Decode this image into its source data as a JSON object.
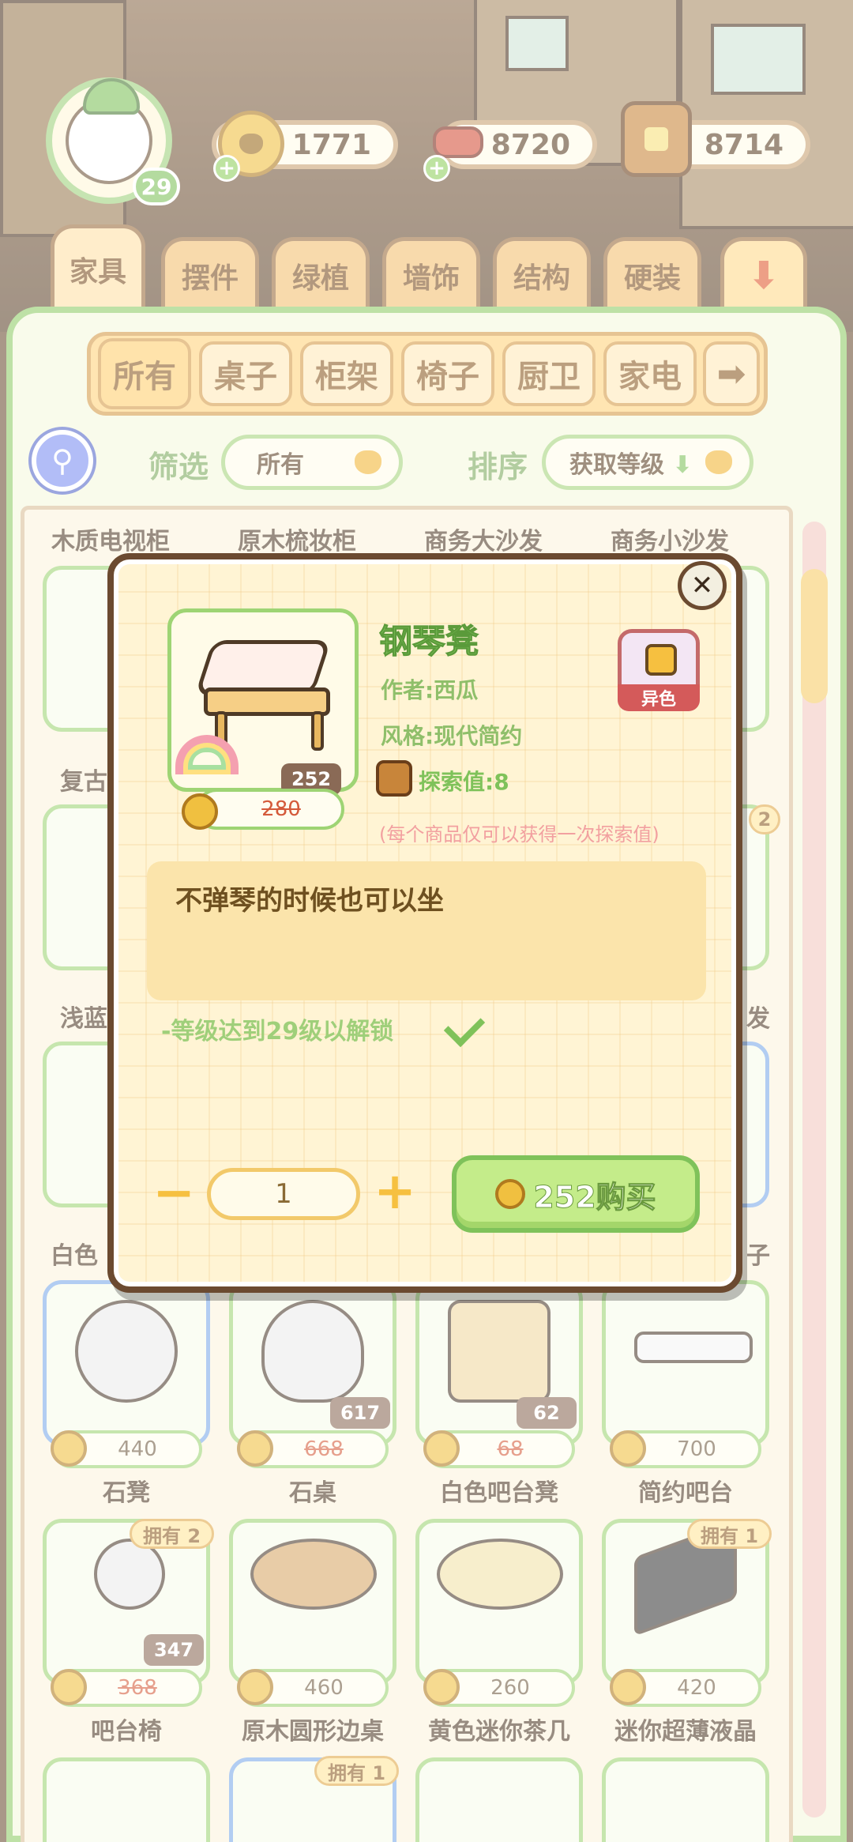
{
  "player": {
    "level": "29"
  },
  "resources": [
    {
      "name": "coins",
      "value": "1771",
      "icon": "coin-icon"
    },
    {
      "name": "material",
      "value": "8720",
      "icon": "dumbbell-icon"
    },
    {
      "name": "exploration",
      "value": "8714",
      "icon": "book-icon"
    }
  ],
  "tabs": [
    "家具",
    "摆件",
    "绿植",
    "墙饰",
    "结构",
    "硬装"
  ],
  "subtabs": [
    "所有",
    "桌子",
    "柜架",
    "椅子",
    "厨卫",
    "家电"
  ],
  "filter": {
    "label": "筛选",
    "value": "所有"
  },
  "sort": {
    "label": "排序",
    "value": "获取等级"
  },
  "column_titles": [
    "木质电视柜",
    "原木梳妆柜",
    "商务大沙发",
    "商务小沙发"
  ],
  "side_labels": {
    "left1": "复古",
    "left2": "浅蓝",
    "left3": "白色",
    "right2": "发",
    "right3": "子",
    "right_badge": "2"
  },
  "items_row1": [
    {
      "name": "石凳",
      "price": "440"
    },
    {
      "name": "石桌",
      "price": "668",
      "discount": "617"
    },
    {
      "name": "白色吧台凳",
      "price": "68",
      "discount": "62"
    },
    {
      "name": "简约吧台",
      "price": "700"
    }
  ],
  "items_row2": [
    {
      "name": "吧台椅",
      "price": "368",
      "discount": "347",
      "owned": "拥有 2"
    },
    {
      "name": "原木圆形边桌",
      "price": "460"
    },
    {
      "name": "黄色迷你茶几",
      "price": "260"
    },
    {
      "name": "迷你超薄液晶",
      "price": "420",
      "owned": "拥有 1"
    }
  ],
  "items_row3": {
    "owned": "拥有 1"
  },
  "modal": {
    "title": "钢琴凳",
    "author": "作者:西瓜",
    "style": "风格:现代简约",
    "explore": "探索值:8",
    "note": "(每个商品仅可以获得一次探索值)",
    "variant_label": "异色",
    "original_price": "280",
    "discount_price": "252",
    "description": "不弹琴的时候也可以坐",
    "unlock": "-等级达到29级以解锁",
    "minus": "−",
    "plus": "+",
    "quantity": "1",
    "buy_label": "252购买"
  },
  "colors": {
    "accent_green": "#7fc25a",
    "gold": "#f2b534",
    "panel_bg": "#f4f8dc"
  }
}
